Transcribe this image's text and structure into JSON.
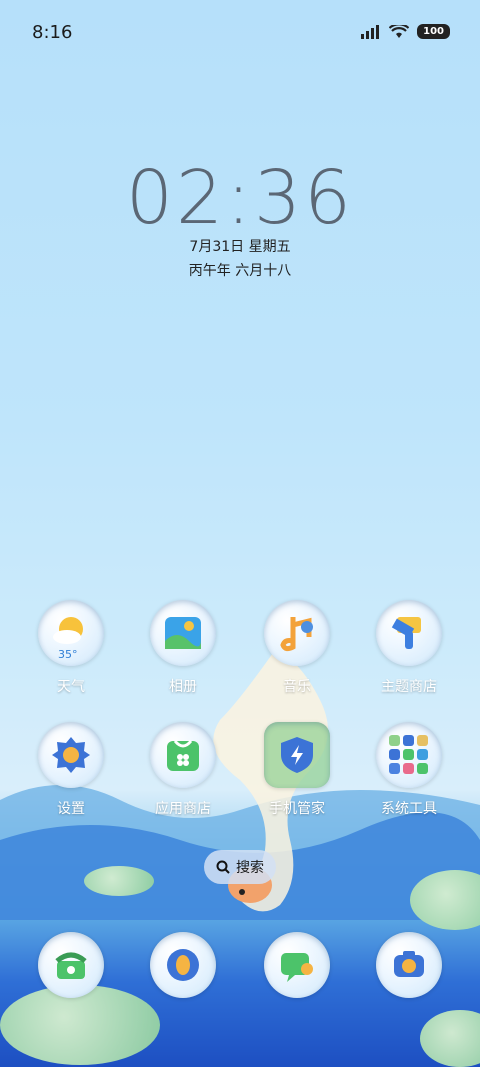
{
  "status": {
    "time": "8:16",
    "battery": "100"
  },
  "clock": {
    "time": "02:36",
    "date": "7月31日 星期五",
    "lunar": "丙午年 六月十八"
  },
  "apps": [
    {
      "label": "天气",
      "temp": "35°"
    },
    {
      "label": "相册"
    },
    {
      "label": "音乐"
    },
    {
      "label": "主题商店"
    },
    {
      "label": "设置"
    },
    {
      "label": "应用商店"
    },
    {
      "label": "手机管家"
    },
    {
      "label": "系统工具"
    }
  ],
  "search": {
    "label": "搜索"
  },
  "dock": [
    "phone",
    "fish-browser",
    "messages",
    "camera"
  ],
  "icons": {
    "weather": "weather-icon",
    "gallery": "gallery-icon",
    "music": "music-icon",
    "themes": "theme-store-icon",
    "settings": "settings-icon",
    "store": "app-store-icon",
    "security": "phone-manager-icon",
    "tools": "system-tools-folder-icon"
  },
  "colors": {
    "accent": "#2f6fd6",
    "sky": "#b6e0fa"
  }
}
